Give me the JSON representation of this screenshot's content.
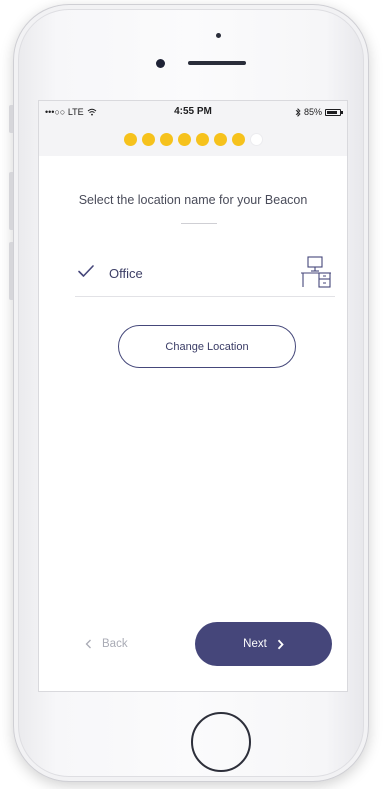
{
  "status_bar": {
    "carrier": "•••○○ LTE",
    "time": "4:55 PM",
    "battery_text": "85%",
    "battery_level": 0.85
  },
  "progress": {
    "total_steps": 8,
    "completed_steps": 7,
    "accent_color": "#f6c21c"
  },
  "prompt": "Select the location name for your Beacon",
  "location": {
    "name": "Office",
    "selected": true,
    "icon": "desk-icon"
  },
  "buttons": {
    "change_location": "Change Location",
    "back": "Back",
    "next": "Next"
  },
  "colors": {
    "primary": "#45467a",
    "accent": "#f6c21c",
    "muted": "#a9abb5"
  }
}
